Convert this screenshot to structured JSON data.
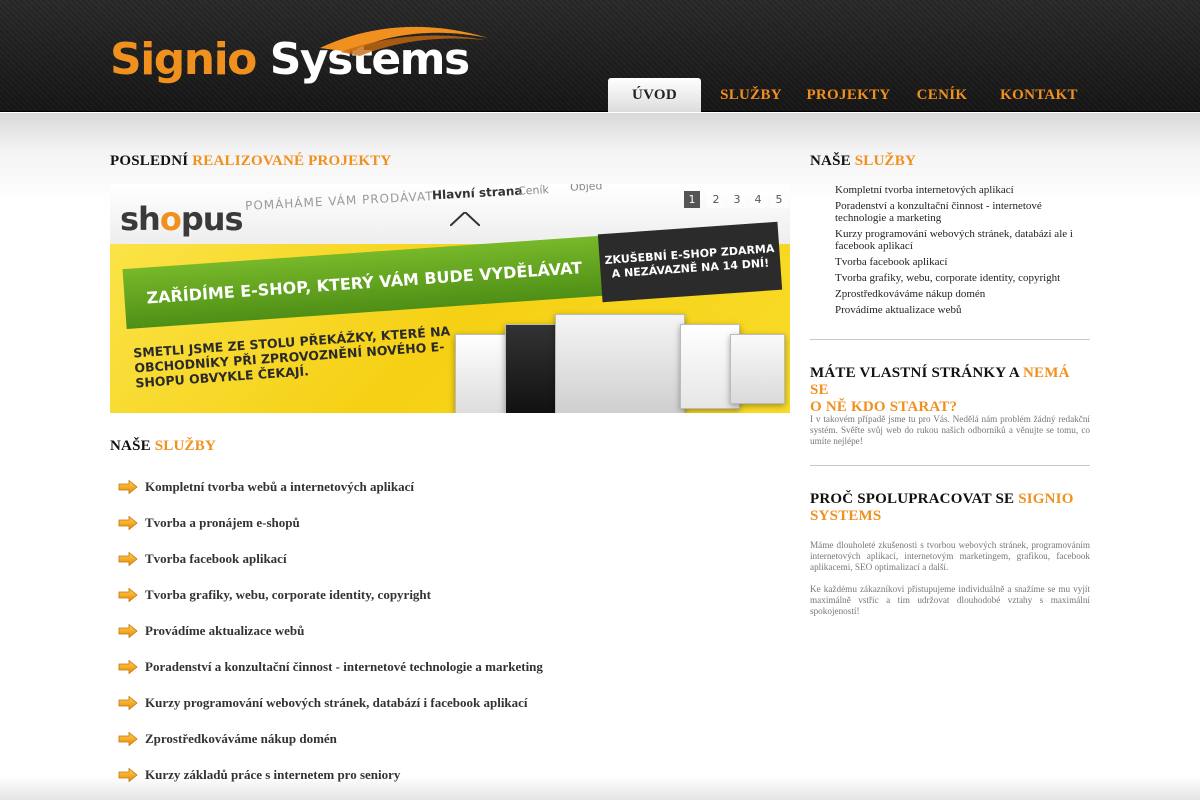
{
  "brand": {
    "word1": "Signio",
    "word2": "Systems"
  },
  "nav": {
    "items": [
      {
        "label": "ÚVOD",
        "active": true
      },
      {
        "label": "SLUŽBY",
        "active": false
      },
      {
        "label": "PROJEKTY",
        "active": false
      },
      {
        "label": "CENÍK",
        "active": false
      },
      {
        "label": "KONTAKT",
        "active": false
      }
    ]
  },
  "projects": {
    "title_prefix": "POSLEDNÍ",
    "title_highlight": "REALIZOVANÉ PROJEKTY",
    "slider": {
      "logo_pre": "sh",
      "logo_o": "o",
      "logo_post": "pus",
      "tagline": "POMÁHÁME VÁM PRODÁVAT",
      "menu": [
        "Hlavní strana",
        "Ceník",
        "Objed"
      ],
      "banner": "ZAŘÍDÍME E-SHOP, KTERÝ VÁM BUDE VYDĚLÁVAT",
      "promo_line1": "ZKUŠEBNÍ E-SHOP ZDARMA",
      "promo_line2": "A NEZÁVAZNĚ NA 14 DNÍ!",
      "sub_text": "SMETLI JSME ZE STOLU PŘEKÁŽKY, KTERÉ NA OBCHODNÍKY PŘI ZPROVOZNĚNÍ NOVÉHO E-SHOPU OBVYKLE ČEKAJÍ.",
      "pages": [
        "1",
        "2",
        "3",
        "4",
        "5"
      ],
      "active_page": 0
    }
  },
  "services": {
    "title_prefix": "NAŠE",
    "title_highlight": "SLUŽBY",
    "items": [
      "Kompletní tvorba webů a internetových aplikací",
      "Tvorba a pronájem e-shopů",
      "Tvorba facebook aplikací",
      "Tvorba grafiky, webu, corporate identity, copyright",
      "Provádíme aktualizace webů",
      "Poradenství a konzultační činnost - internetové technologie a marketing",
      "Kurzy programování webových stránek, databází i facebook aplikací",
      "Zprostředkováváme nákup domén",
      "Kurzy základů práce s internetem pro seniory"
    ]
  },
  "sidebar": {
    "services": {
      "title_prefix": "NAŠE",
      "title_highlight": "SLUŽBY",
      "items": [
        "Kompletní tvorba internetových aplikací",
        "Poradenství a konzultační činnost - internetové technologie a marketing",
        "Kurzy programování webových stránek, databázi ale i facebook aplikací",
        "Tvorba facebook aplikací",
        "Tvorba grafiky, webu, corporate identity, copyright",
        "Zprostředkováváme nákup domén",
        "Provádíme aktualizace webů"
      ]
    },
    "own_site": {
      "title_prefix": "MÁTE VLASTNÍ STRÁNKY A",
      "title_highlight": "NEMÁ SE",
      "title_line2": "O NĚ KDO STARAT?",
      "text": "I v takovém případě jsme tu pro Vás. Nedělá nám problém žádný redakční systém. Svěřte svůj web do rukou našich odborníků a věnujte se tomu, co umíte nejlépe!"
    },
    "why": {
      "title_prefix": "PROČ SPOLUPRACOVAT SE",
      "title_highlight": "SIGNIO",
      "title_highlight2": "SYSTEMS",
      "text1": "Máme dlouholeté zkušenosti s tvorbou webových stránek, programováním internetových aplikací, internetovým marketingem, grafikou, facebook aplikacemi, SEO optimalizací a další.",
      "text2": "Ke každému zákazníkovi přistupujeme individuálně a snažíme se mu vyjít maximálně vstříc a tím udržovat dlouhodobé vztahy s maximální spokojeností!"
    }
  },
  "colors": {
    "accent": "#f0901e",
    "header_bg": "#1e1e1e",
    "text": "#333333"
  }
}
